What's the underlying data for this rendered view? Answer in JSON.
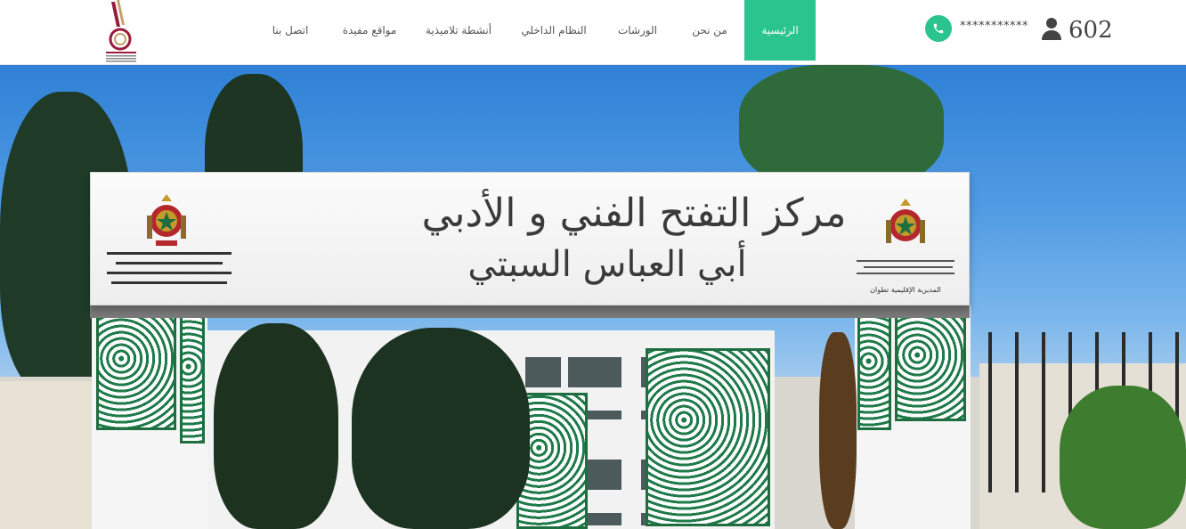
{
  "header": {
    "nav": [
      {
        "label": "الرئيسية",
        "active": true
      },
      {
        "label": "من نحن",
        "active": false
      },
      {
        "label": "الورشات",
        "active": false
      },
      {
        "label": "النظام الداخلي",
        "active": false
      },
      {
        "label": "أنشطة تلاميذية",
        "active": false
      },
      {
        "label": "مواقع مفيدة",
        "active": false
      },
      {
        "label": "اتصل بنا",
        "active": false
      }
    ],
    "phone": "***********",
    "phone_icon": "phone-icon",
    "visitor_icon": "user-icon",
    "visitor_count": "602"
  },
  "hero": {
    "sign_title": "مركز التفتح الفني و الأدبي",
    "sign_subtitle": "أبي العباس السبتي",
    "sign_right_text": "المديرية الإقليمية تطوان"
  },
  "colors": {
    "accent": "#2cc48e",
    "nav_text": "#555555"
  }
}
